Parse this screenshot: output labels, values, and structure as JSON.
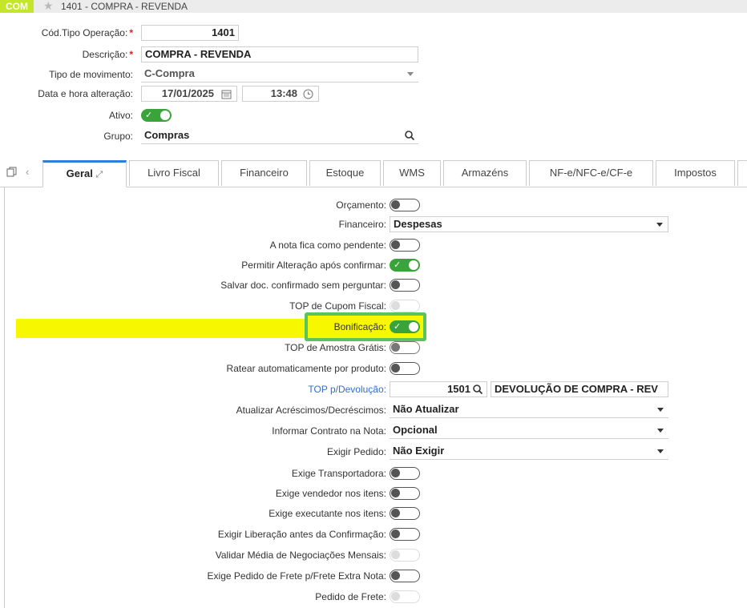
{
  "window": {
    "badge": "COM",
    "title": "1401 - COMPRA - REVENDA"
  },
  "header": {
    "cod_tipo_label": "Cód.Tipo Operação:",
    "cod_tipo_value": "1401",
    "descricao_label": "Descrição:",
    "descricao_value": "COMPRA - REVENDA",
    "tipo_mov_label": "Tipo de movimento:",
    "tipo_mov_value": "C-Compra",
    "data_label": "Data e hora alteração:",
    "data_value": "17/01/2025",
    "hora_value": "13:48",
    "ativo_label": "Ativo:",
    "grupo_label": "Grupo:",
    "grupo_value": "Compras",
    "required_mark": "*"
  },
  "tabs": [
    "Geral",
    "Livro Fiscal",
    "Financeiro",
    "Estoque",
    "WMS",
    "Armazéns",
    "NF-e/NFC-e/CF-e",
    "Impostos"
  ],
  "form": {
    "orcamento": "Orçamento:",
    "financeiro": "Financeiro:",
    "financeiro_value": "Despesas",
    "nota_pendente": "A nota fica como pendente:",
    "permitir_alteracao": "Permitir Alteração após confirmar:",
    "salvar_doc": "Salvar doc. confirmado sem perguntar:",
    "top_cupom": "TOP de Cupom Fiscal:",
    "bonificacao": "Bonificação:",
    "top_amostra": "TOP de Amostra Grátis:",
    "ratear": "Ratear automaticamente por produto:",
    "top_devolucao": "TOP p/Devolução:",
    "top_devolucao_code": "1501",
    "top_devolucao_desc": "DEVOLUÇÃO DE COMPRA - REV",
    "atualizar_acresc": "Atualizar Acréscimos/Decréscimos:",
    "atualizar_acresc_value": "Não Atualizar",
    "informar_contrato": "Informar Contrato na Nota:",
    "informar_contrato_value": "Opcional",
    "exigir_pedido": "Exigir Pedido:",
    "exigir_pedido_value": "Não Exigir",
    "exige_transportadora": "Exige Transportadora:",
    "exige_vendedor": "Exige vendedor nos itens:",
    "exige_executante": "Exige executante nos itens:",
    "exigir_liberacao": "Exigir Liberação antes da Confirmação:",
    "validar_media": "Validar Média de Negociações Mensais:",
    "exige_pedido_frete": "Exige Pedido de Frete p/Frete Extra Nota:",
    "pedido_frete": "Pedido de Frete:"
  },
  "colors": {
    "accent": "#3aa43a",
    "badge": "#c4e62a",
    "highlight": "#f7f700",
    "link": "#2f6fcf",
    "tab_active": "#2f7fd6"
  }
}
